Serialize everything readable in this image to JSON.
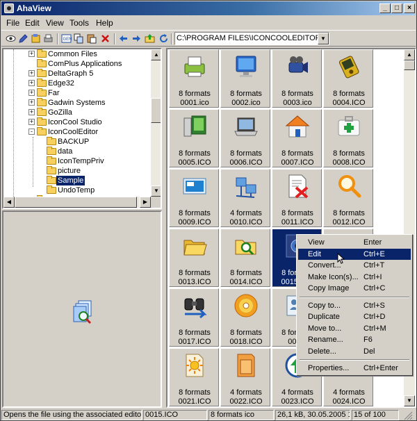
{
  "window": {
    "title": "AhaView"
  },
  "menu": [
    "File",
    "Edit",
    "View",
    "Tools",
    "Help"
  ],
  "toolbar": {
    "icons": [
      "view-icon",
      "edit-icon",
      "convert-icon",
      "print-icon",
      "fit-icon",
      "copy-icon",
      "paste-icon",
      "delete-icon",
      "back-icon",
      "forward-icon",
      "up-icon",
      "refresh-icon"
    ],
    "path": "C:\\PROGRAM FILES\\ICONCOOLEDITOR\\S"
  },
  "tree": [
    {
      "label": "Common Files",
      "depth": 1,
      "expander": "+"
    },
    {
      "label": "ComPlus Applications",
      "depth": 1,
      "expander": ""
    },
    {
      "label": "DeltaGraph 5",
      "depth": 1,
      "expander": "+"
    },
    {
      "label": "Edge32",
      "depth": 1,
      "expander": "+"
    },
    {
      "label": "Far",
      "depth": 1,
      "expander": "+"
    },
    {
      "label": "Gadwin Systems",
      "depth": 1,
      "expander": "+"
    },
    {
      "label": "GoZilla",
      "depth": 1,
      "expander": "+"
    },
    {
      "label": "IconCool Studio",
      "depth": 1,
      "expander": "+"
    },
    {
      "label": "IconCoolEditor",
      "depth": 1,
      "expander": "-"
    },
    {
      "label": "BACKUP",
      "depth": 2,
      "expander": ""
    },
    {
      "label": "data",
      "depth": 2,
      "expander": ""
    },
    {
      "label": "IconTempPriv",
      "depth": 2,
      "expander": ""
    },
    {
      "label": "picture",
      "depth": 2,
      "expander": ""
    },
    {
      "label": "Sample",
      "depth": 2,
      "expander": "",
      "selected": true
    },
    {
      "label": "UndoTemp",
      "depth": 2,
      "expander": ""
    },
    {
      "label": "IconForge7",
      "depth": 1,
      "expander": "+"
    }
  ],
  "icons": [
    {
      "cap1": "8 formats",
      "cap2": "0001.ico",
      "icon": "printer-icon"
    },
    {
      "cap1": "8 formats",
      "cap2": "0002.ico",
      "icon": "monitor-icon"
    },
    {
      "cap1": "8 formats",
      "cap2": "0003.ico",
      "icon": "camcorder-icon"
    },
    {
      "cap1": "8 formats",
      "cap2": "0004.ICO",
      "icon": "pda-icon"
    },
    {
      "cap1": "8 formats",
      "cap2": "0005.ICO",
      "icon": "computer-icon"
    },
    {
      "cap1": "8 formats",
      "cap2": "0006.ICO",
      "icon": "laptop-icon"
    },
    {
      "cap1": "8 formats",
      "cap2": "0007.ICO",
      "icon": "home-icon"
    },
    {
      "cap1": "8 formats",
      "cap2": "0008.ICO",
      "icon": "first-aid-icon"
    },
    {
      "cap1": "8 formats",
      "cap2": "0009.ICO",
      "icon": "screen-icon"
    },
    {
      "cap1": "4 formats",
      "cap2": "0010.ICO",
      "icon": "network-icon"
    },
    {
      "cap1": "8 formats",
      "cap2": "0011.ICO",
      "icon": "delete-doc-icon"
    },
    {
      "cap1": "8 formats",
      "cap2": "0012.ICO",
      "icon": "magnifier-icon"
    },
    {
      "cap1": "8 formats",
      "cap2": "0013.ICO",
      "icon": "open-folder-icon"
    },
    {
      "cap1": "8 formats",
      "cap2": "0014.ICO",
      "icon": "search-folder-icon"
    },
    {
      "cap1": "8 formats",
      "cap2": "0015.ICO",
      "icon": "photo-icon",
      "selected": true
    },
    {
      "cap1": "",
      "cap2": "",
      "icon": "hidden-icon"
    },
    {
      "cap1": "8 formats",
      "cap2": "0017.ICO",
      "icon": "binoculars-icon"
    },
    {
      "cap1": "8 formats",
      "cap2": "0018.ICO",
      "icon": "cd-icon"
    },
    {
      "cap1": "8 formats",
      "cap2": "0019.",
      "icon": "contact-icon"
    },
    {
      "cap1": "",
      "cap2": "",
      "icon": "hidden-icon"
    },
    {
      "cap1": "8 formats",
      "cap2": "0021.ICO",
      "icon": "sun-doc-icon"
    },
    {
      "cap1": "4 formats",
      "cap2": "0022.ICO",
      "icon": "folder-doc-icon"
    },
    {
      "cap1": "4 formats",
      "cap2": "0023.ICO",
      "icon": "upload-icon"
    },
    {
      "cap1": "4 formats",
      "cap2": "0024.ICO",
      "icon": "blank-icon"
    }
  ],
  "context_menu": [
    {
      "label": "View",
      "key": "Enter"
    },
    {
      "label": "Edit",
      "key": "Ctrl+E",
      "highlight": true
    },
    {
      "label": "Convert...",
      "key": "Ctrl+T"
    },
    {
      "label": "Make Icon(s)...",
      "key": "Ctrl+I"
    },
    {
      "label": "Copy Image",
      "key": "Ctrl+C"
    },
    {
      "sep": true
    },
    {
      "label": "Copy to...",
      "key": "Ctrl+S"
    },
    {
      "label": "Duplicate",
      "key": "Ctrl+D"
    },
    {
      "label": "Move to...",
      "key": "Ctrl+M"
    },
    {
      "label": "Rename...",
      "key": "F6"
    },
    {
      "label": "Delete...",
      "key": "Del"
    },
    {
      "sep": true
    },
    {
      "label": "Properties...",
      "key": "Ctrl+Enter"
    }
  ],
  "status": {
    "hint": "Opens the file using the associated editor",
    "file": "0015.ICO",
    "formats": "8 formats ico",
    "info": "26,1 kB, 30.05.2005 16:5",
    "count": "15 of 100"
  }
}
